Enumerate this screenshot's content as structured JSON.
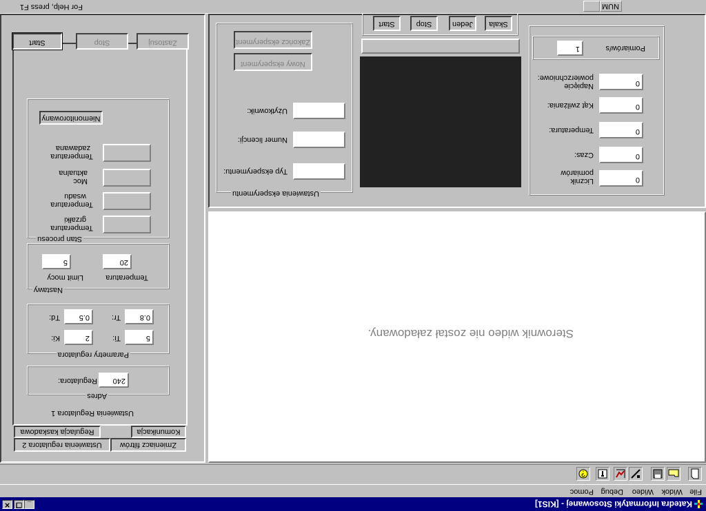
{
  "window": {
    "title": "Katedra Informatyki Stosowanej - [KIS1]",
    "controls": {
      "minimize": "_",
      "restore": "❐",
      "close": "✕"
    }
  },
  "menu": [
    "File",
    "Widok",
    "Wideo",
    "Debug",
    "Pomoc"
  ],
  "toolbar": [
    "new-document-icon",
    "open-folder-icon",
    "save-icon",
    "draw-icon",
    "chart-icon",
    "properties-icon",
    "help-icon"
  ],
  "left_panel": {
    "buttons": {
      "start": "Start",
      "stop": "Stop",
      "zastosuj": "Zastosuj"
    },
    "tabs": [
      "Ustawienia regulatora 2",
      "Zmieniacz filtrów",
      "Regulacja kaskadowa",
      "Komunikacja"
    ],
    "active_tab_title": "Ustawienia Regulatora 1",
    "adres": {
      "title": "Adres",
      "label": "Regulatora:",
      "value": "240"
    },
    "parametry": {
      "title": "Parametry regulatora",
      "ki": {
        "label": "Ki:",
        "value": "2"
      },
      "ti": {
        "label": "Ti:",
        "value": "5"
      },
      "td": {
        "label": "Td:",
        "value": "0.5"
      },
      "tr": {
        "label": "Tr:",
        "value": "0.8"
      }
    },
    "nastawy": {
      "title": "Nastawy",
      "limit_label": "Limit mocy",
      "limit_value": "5",
      "temp_label": "Temperatura",
      "temp_value": "20"
    },
    "stan": {
      "title": "Stan procesu",
      "rows": [
        {
          "line1": "Temperatura",
          "line2": "grzałki"
        },
        {
          "line1": "Temperatura",
          "line2": "wsadu"
        },
        {
          "line1": "Moc",
          "line2": "aktualna"
        },
        {
          "line1": "Temperatura",
          "line2": "zadawana"
        }
      ],
      "mode_button": "Niemonitorowany"
    }
  },
  "experiment": {
    "title": "Ustawienia eksperymentu",
    "buttons": {
      "end": "Zakończ eksperyment",
      "new": "Nowy eksperyment"
    },
    "fields": {
      "user": {
        "label": "Użytkownik:",
        "value": ""
      },
      "license": {
        "label": "Numer licencji:",
        "value": ""
      },
      "type": {
        "label": "Typ eksperymentu:",
        "value": ""
      }
    }
  },
  "video": {
    "buttons": {
      "start": "Start",
      "stop": "Stop",
      "jeden": "Jeden",
      "skala": "Skala"
    },
    "status": "",
    "message": "Sterownik wideo nie został załadowany."
  },
  "measurements": {
    "pomiarow_s": {
      "label": "Pomiarów/s",
      "value": "1"
    },
    "napiecie": {
      "label1": "Napięcie",
      "label2": "powierzchniowe:",
      "value": "0"
    },
    "kat": {
      "label": "Kąt zwilżania:",
      "value": "0"
    },
    "temperatura": {
      "label": "Temperatura:",
      "value": "0"
    },
    "czas": {
      "label": "Czas:",
      "value": "0"
    },
    "licznik": {
      "label1": "Licznik",
      "label2": "pomiarów",
      "value": "0"
    }
  },
  "statusbar": {
    "help": "For Help, press F1",
    "num": "NUM"
  },
  "colors": {
    "titlebar": "#000080",
    "face": "#c0c0c0",
    "video_preview": "#222222"
  }
}
